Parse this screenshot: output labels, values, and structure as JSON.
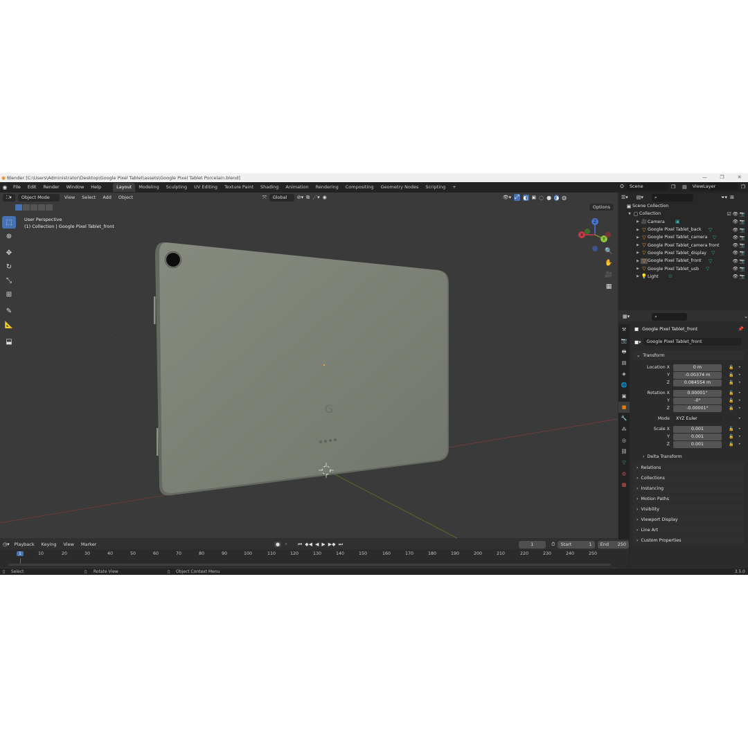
{
  "title_bar": {
    "text": "Blender [C:\\Users\\Administrator\\Desktop\\Google Pixel Tablet\\assets\\Google Pixel Tablet Porcelain.blend]"
  },
  "menu": [
    "File",
    "Edit",
    "Render",
    "Window",
    "Help"
  ],
  "workspaces": [
    "Layout",
    "Modeling",
    "Sculpting",
    "UV Editing",
    "Texture Paint",
    "Shading",
    "Animation",
    "Rendering",
    "Compositing",
    "Geometry Nodes",
    "Scripting"
  ],
  "scene": "Scene",
  "view_layer": "ViewLayer",
  "viewport": {
    "mode": "Object Mode",
    "menus": [
      "View",
      "Select",
      "Add",
      "Object"
    ],
    "orientation": "Global",
    "options_label": "Options",
    "info_line1": "User Perspective",
    "info_line2": "(1) Collection | Google Pixel Tablet_front"
  },
  "outliner": {
    "scene_collection": "Scene Collection",
    "collection": "Collection",
    "items": [
      "Camera",
      "Google Pixel Tablet_back",
      "Google Pixel Tablet_camera",
      "Google Pixel Tablet_camera front",
      "Google Pixel Tablet_display",
      "Google Pixel Tablet_front",
      "Google Pixel Tablet_usb",
      "Light"
    ]
  },
  "properties": {
    "object_name": "Google Pixel Tablet_front",
    "object_field": "Google Pixel Tablet_front",
    "transform_label": "Transform",
    "location": {
      "label": "Location X",
      "x": "0 m",
      "y": "-0.00374 m",
      "z": "0.084554 m"
    },
    "rotation": {
      "label": "Rotation X",
      "x": "0.00001°",
      "y": "-0°",
      "z": "-0.00001°"
    },
    "mode_label": "Mode",
    "mode_value": "XYZ Euler",
    "scale": {
      "label": "Scale X",
      "x": "0.001",
      "y": "0.001",
      "z": "0.001"
    },
    "axis_y": "Y",
    "axis_z": "Z",
    "delta_transform": "Delta Transform",
    "panels": [
      "Relations",
      "Collections",
      "Instancing",
      "Motion Paths",
      "Visibility",
      "Viewport Display",
      "Line Art",
      "Custom Properties"
    ]
  },
  "timeline": {
    "menus": [
      "Playback",
      "Keying",
      "View",
      "Marker"
    ],
    "current_frame": "1",
    "start_label": "Start",
    "start": "1",
    "end_label": "End",
    "end": "250",
    "ruler": [
      "1",
      "10",
      "20",
      "30",
      "40",
      "50",
      "60",
      "70",
      "80",
      "90",
      "100",
      "110",
      "120",
      "130",
      "140",
      "150",
      "160",
      "170",
      "180",
      "190",
      "200",
      "210",
      "220",
      "230",
      "240",
      "250"
    ]
  },
  "statusbar": {
    "select": "Select",
    "rotate": "Rotate View",
    "context": "Object Context Menu",
    "version": "3.5.0"
  },
  "colors": {
    "accent": "#4772b3",
    "orange": "#e87d0d",
    "tablet": "#7f8479"
  }
}
